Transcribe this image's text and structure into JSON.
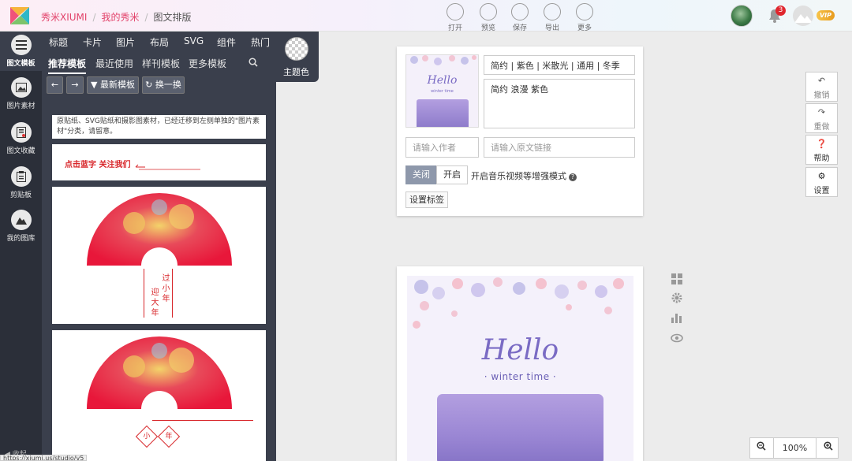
{
  "header": {
    "brand": "秀米XIUMI",
    "crumb_mine": "我的秀米",
    "crumb_current": "图文排版",
    "toolbar": [
      {
        "label": "打开",
        "icon": "folder-icon"
      },
      {
        "label": "预览",
        "icon": "preview-icon"
      },
      {
        "label": "保存",
        "icon": "save-icon"
      },
      {
        "label": "导出",
        "icon": "export-icon"
      },
      {
        "label": "更多",
        "icon": "more-icon"
      }
    ],
    "notification_count": "3",
    "vip_label": "VIP"
  },
  "rail": [
    {
      "label": "图文模板",
      "icon": "template-icon"
    },
    {
      "label": "图片素材",
      "icon": "image-icon"
    },
    {
      "label": "图文收藏",
      "icon": "favorites-icon"
    },
    {
      "label": "剪贴板",
      "icon": "clipboard-icon"
    },
    {
      "label": "我的图库",
      "icon": "gallery-icon"
    }
  ],
  "rail_footer": "收起",
  "panel": {
    "categories": [
      "标题",
      "卡片",
      "图片",
      "布局",
      "SVG",
      "组件",
      "热门"
    ],
    "subtabs": [
      "推荐模板",
      "最近使用",
      "样刊模板",
      "更多模板"
    ],
    "theme_label": "主题色",
    "latest_button": "最新模板",
    "shuffle_button": "换一换",
    "notice": "原贴纸、SVG贴纸和摄影图素材，已经迁移到左侧单独的\"图片素材\"分类，请留意。",
    "follow_text": "点击蓝字 关注我们",
    "fan_text_1": "过小年",
    "fan_text_2": "迎大年",
    "diamond_1": "小",
    "diamond_2": "年"
  },
  "settings": {
    "tags_value": "简约 | 紫色 | 米散光 | 通用 | 冬季",
    "summary_value": "简约 浪漫 紫色",
    "author_placeholder": "请输入作者",
    "link_placeholder": "请输入原文链接",
    "toggle_off": "关闭",
    "toggle_on": "开启",
    "enhanced_mode_label": "开启音乐视频等增强模式",
    "tag_button": "设置标签",
    "cover_title": "Hello",
    "cover_sub": "winter time"
  },
  "actions": [
    {
      "label": "撤销",
      "icon": "undo-icon"
    },
    {
      "label": "重做",
      "icon": "redo-icon"
    },
    {
      "label": "帮助",
      "icon": "help-icon"
    },
    {
      "label": "设置",
      "icon": "settings-icon"
    }
  ],
  "article": {
    "title": "Hello",
    "subtitle": "· winter time ·"
  },
  "zoom": {
    "value": "100%"
  },
  "status_url": "https://xiumi.us/studio/v5",
  "colors": {
    "brand": "#e2426a",
    "accent": "#7a6bc4",
    "panel": "#3a3f4c",
    "rail": "#2b2f39"
  }
}
